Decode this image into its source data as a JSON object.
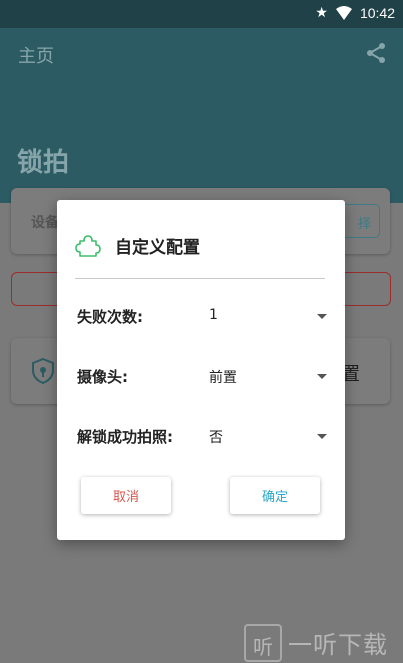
{
  "status_bar": {
    "time": "10:42",
    "icons": [
      "star-icon",
      "wifi-icon"
    ]
  },
  "app_bar": {
    "nav_title": "主页",
    "page_title": "锁拍",
    "share_icon": "share-icon"
  },
  "background": {
    "card1_label": "设备",
    "card1_button_partial": "择",
    "card3_text_partial": "置"
  },
  "dialog": {
    "title": "自定义配置",
    "title_icon": "puzzle-icon",
    "rows": [
      {
        "label": "失败次数:",
        "value": "1"
      },
      {
        "label": "摄像头:",
        "value": "前置"
      },
      {
        "label": "解锁成功拍照:",
        "value": "否"
      }
    ],
    "cancel_label": "取消",
    "ok_label": "确定"
  },
  "watermark": {
    "glyph": "听",
    "text": "一听下载"
  },
  "colors": {
    "app_bar": "#2d5b63",
    "status_bar": "#1f4147",
    "cancel": "#d6574d",
    "confirm": "#2aa8c9",
    "puzzle_icon": "#3cbf6a"
  }
}
